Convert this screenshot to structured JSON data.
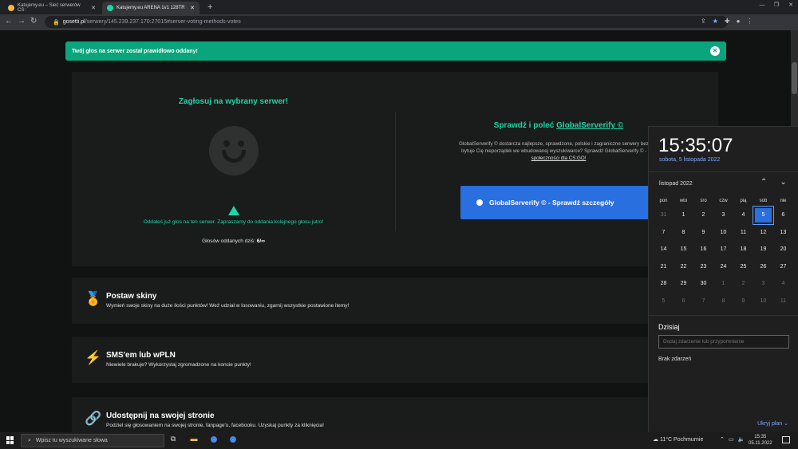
{
  "browser": {
    "tabs": [
      {
        "title": "Katujemy.eu – Sieć serwerów CS:",
        "active": false
      },
      {
        "title": "Katujemy.eu ARENA 1v1 128TR",
        "active": true
      }
    ],
    "new_tab": "+",
    "url_host": "gosetti.pl",
    "url_path": "/serwery/145.239.237.170:27015#server-voting-methods-votes"
  },
  "alert": {
    "message": "Twój głos na serwer został prawidłowo oddany!",
    "close": "✕"
  },
  "vote": {
    "title": "Zagłosuj na wybrany serwer!",
    "message": "Oddałeś już głos na ten serwer. Zapraszamy do oddania kolejnego głosu jutro!",
    "count_label": "Głosów oddanych dziś:",
    "count_value": "6/∞"
  },
  "globalserverify": {
    "title_prefix": "Sprawdź i poleć",
    "title_link": "GlobalServerify ©",
    "desc_line1": "GlobalServerify © dostarcza najlepsze, sprawdzone, polskie i zagraniczne serwery bezpośr",
    "desc_line2": "Irytuje Cię nieporządek we wbudowanej wyszukiwarce? Sprawdź GlobalServerify © - dos",
    "desc_line3": "społeczności dla CS:GO!",
    "button": "GlobalServerify © - Sprawdź szczegóły"
  },
  "cards": [
    {
      "title": "Postaw skiny",
      "desc": "Wymień swoje skiny na duże ilości punktów! Weź udział w losowaniu, zgarnij wszystkie postawione itemy!",
      "icon": "award-icon"
    },
    {
      "title": "SMS'em lub wPLN",
      "desc": "Niewiele brakuje? Wykorzystaj zgromadzone na koncie punkty!",
      "icon": "lightning-icon"
    },
    {
      "title": "Udostępnij na swojej stronie",
      "desc": "Podziel się głosowaniem na swojej stronie, fanpage'u, facebooku. Uzyskaj punkty za kliknięcia!",
      "icon": "link-icon"
    }
  ],
  "calendar": {
    "time": "15:35:07",
    "date": "sobota, 5 listopada 2022",
    "month": "listopad 2022",
    "weekdays": [
      "pon",
      "wto",
      "śro",
      "czw",
      "pią",
      "sob",
      "nie"
    ],
    "days": [
      [
        "31",
        true
      ],
      [
        "1",
        false
      ],
      [
        "2",
        false
      ],
      [
        "3",
        false
      ],
      [
        "4",
        false
      ],
      [
        "5",
        false
      ],
      [
        "6",
        false
      ],
      [
        "7",
        false
      ],
      [
        "8",
        false
      ],
      [
        "9",
        false
      ],
      [
        "10",
        false
      ],
      [
        "11",
        false
      ],
      [
        "12",
        false
      ],
      [
        "13",
        false
      ],
      [
        "14",
        false
      ],
      [
        "15",
        false
      ],
      [
        "16",
        false
      ],
      [
        "17",
        false
      ],
      [
        "18",
        false
      ],
      [
        "19",
        false
      ],
      [
        "20",
        false
      ],
      [
        "21",
        false
      ],
      [
        "22",
        false
      ],
      [
        "23",
        false
      ],
      [
        "24",
        false
      ],
      [
        "25",
        false
      ],
      [
        "26",
        false
      ],
      [
        "27",
        false
      ],
      [
        "28",
        false
      ],
      [
        "29",
        false
      ],
      [
        "30",
        false
      ],
      [
        "1",
        true
      ],
      [
        "2",
        true
      ],
      [
        "3",
        true
      ],
      [
        "4",
        true
      ],
      [
        "5",
        true
      ],
      [
        "6",
        true
      ],
      [
        "7",
        true
      ],
      [
        "8",
        true
      ],
      [
        "9",
        true
      ],
      [
        "10",
        true
      ],
      [
        "11",
        true
      ]
    ],
    "today_index": 5,
    "agenda_title": "Dzisiaj",
    "agenda_placeholder": "Dodaj zdarzenie lub przypomnienie",
    "agenda_none": "Brak zdarzeń",
    "hide_plan": "Ukryj plan ⌄"
  },
  "taskbar": {
    "search_placeholder": "Wpisz tu wyszukiwane słowa",
    "weather": "11°C  Pochmurnie",
    "clock_time": "15:35",
    "clock_date": "05.11.2022"
  },
  "colors": {
    "accent": "#1ed5a5",
    "alert_bg": "#0aa57c",
    "button_blue": "#2a6fe0"
  }
}
